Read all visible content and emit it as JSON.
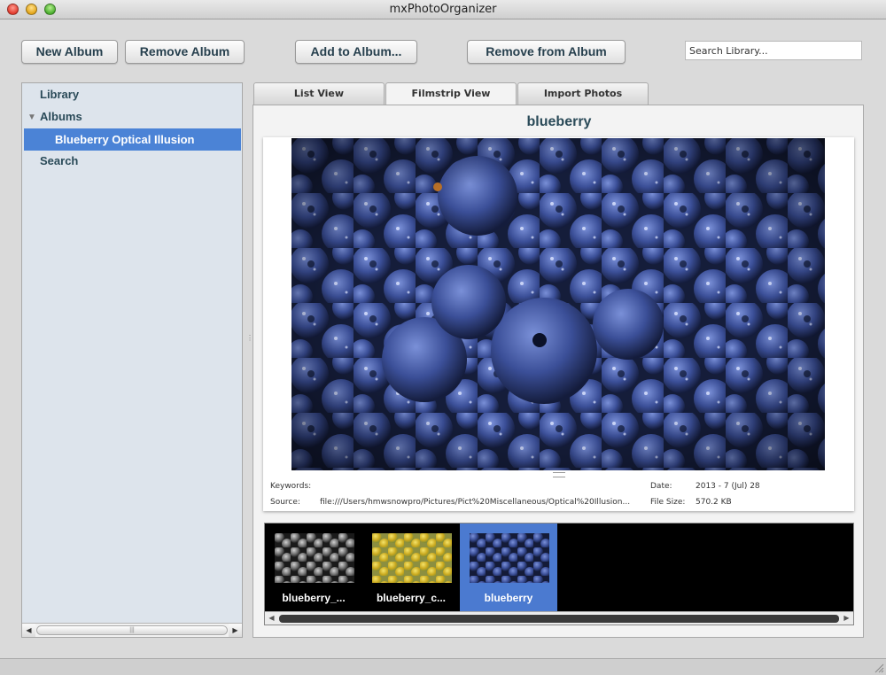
{
  "window": {
    "title": "mxPhotoOrganizer"
  },
  "toolbar": {
    "new_album": "New Album",
    "remove_album": "Remove Album",
    "add_to_album": "Add to Album...",
    "remove_from_album": "Remove from  Album",
    "search_placeholder": "Search Library..."
  },
  "sidebar": {
    "library": "Library",
    "albums": "Albums",
    "selected_album": "Blueberry Optical Illusion",
    "search": "Search"
  },
  "tabs": [
    {
      "label": "List View"
    },
    {
      "label": "Filmstrip View"
    },
    {
      "label": "Import Photos"
    }
  ],
  "photo": {
    "title": "blueberry",
    "keywords_label": "Keywords:",
    "keywords": "",
    "source_label": "Source:",
    "source": "file:///Users/hmwsnowpro/Pictures/Pict%20Miscellaneous/Optical%20Illusion...",
    "date_label": "Date:",
    "date": "2013 - 7   (Jul)   28",
    "filesize_label": "File Size:",
    "filesize": "570.2 KB"
  },
  "filmstrip": [
    {
      "label": "blueberry_...",
      "variant": "grayscale"
    },
    {
      "label": "blueberry_c...",
      "variant": "yellow"
    },
    {
      "label": "blueberry",
      "variant": "blue",
      "selected": true
    }
  ],
  "colors": {
    "accent": "#4b83d6",
    "text": "#2a4a58",
    "sidebar_bg": "#dde4ec"
  }
}
